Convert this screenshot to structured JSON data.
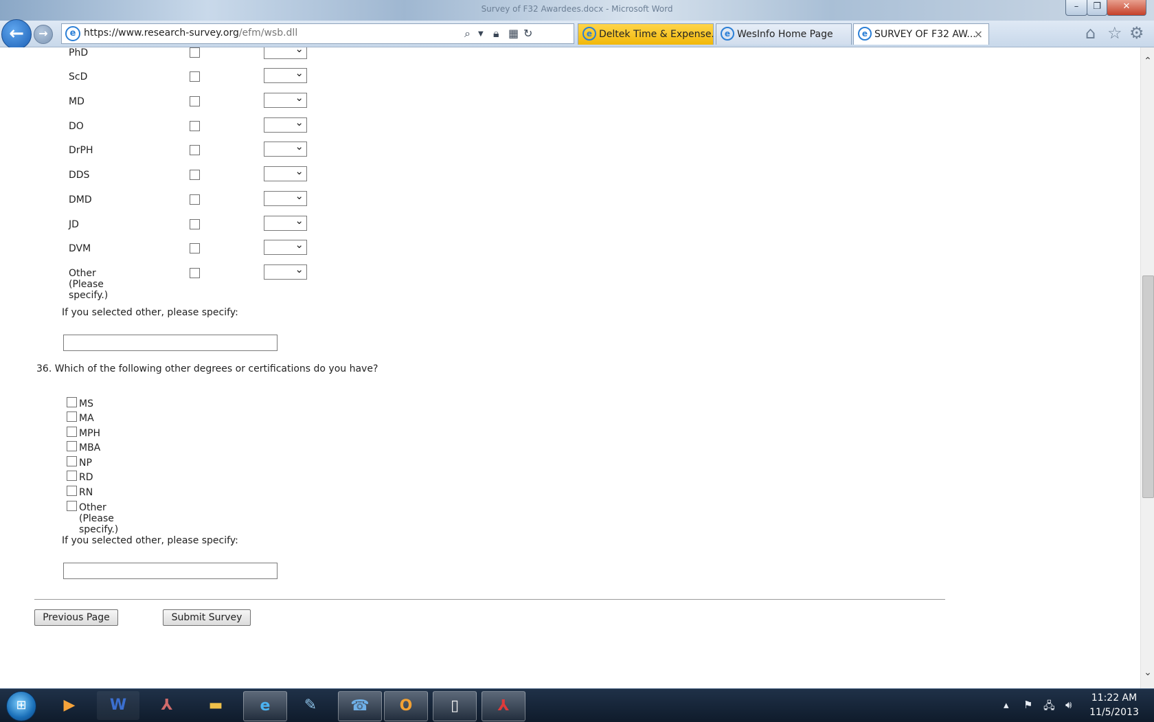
{
  "window": {
    "title": "Survey of F32 Awardees.docx - Microsoft Word",
    "min_glyph": "–",
    "max_glyph": "❐",
    "close_glyph": "✕"
  },
  "browser": {
    "url_base": "https://www.research-survey.org",
    "url_path": "/efm/wsb.dll",
    "tabs": [
      {
        "label": "Deltek Time & Expense..."
      },
      {
        "label": "WesInfo Home Page"
      },
      {
        "label": "SURVEY OF F32 AW..."
      }
    ],
    "tab_close_glyph": "×",
    "back_glyph": "←",
    "forward_glyph": "→",
    "icons": [
      "ie-icon",
      "search-icon",
      "lock-icon",
      "compat-icon",
      "refresh-icon",
      "home-icon",
      "star-icon",
      "gear-icon"
    ]
  },
  "survey": {
    "degree_rows": [
      {
        "label": "PhD"
      },
      {
        "label": "ScD"
      },
      {
        "label": "MD"
      },
      {
        "label": "DO"
      },
      {
        "label": "DrPH"
      },
      {
        "label": "DDS"
      },
      {
        "label": "DMD"
      },
      {
        "label": "JD"
      },
      {
        "label": "DVM"
      },
      {
        "label": "Other (Please specify.)"
      }
    ],
    "specify_label_1": "If you selected other, please specify:",
    "specify_value_1": "",
    "question_36": "36. Which of the following other degrees or certifications do you have?",
    "q36_options": [
      {
        "label": "MS"
      },
      {
        "label": "MA"
      },
      {
        "label": "MPH"
      },
      {
        "label": "MBA"
      },
      {
        "label": "NP"
      },
      {
        "label": "RD"
      },
      {
        "label": "RN"
      },
      {
        "label": "Other (Please specify.)"
      }
    ],
    "specify_label_2": "If you selected other, please specify:",
    "specify_value_2": "",
    "prev_label": "Previous Page",
    "submit_label": "Submit Survey"
  },
  "taskbar": {
    "apps": [
      "windows-media-player",
      "microsoft-word",
      "adobe-acrobat",
      "windows-explorer",
      "internet-explorer",
      "sticky-notes",
      "lync",
      "outlook",
      "blank-document",
      "adobe-reader"
    ],
    "time": "11:22 AM",
    "date": "11/5/2013"
  }
}
